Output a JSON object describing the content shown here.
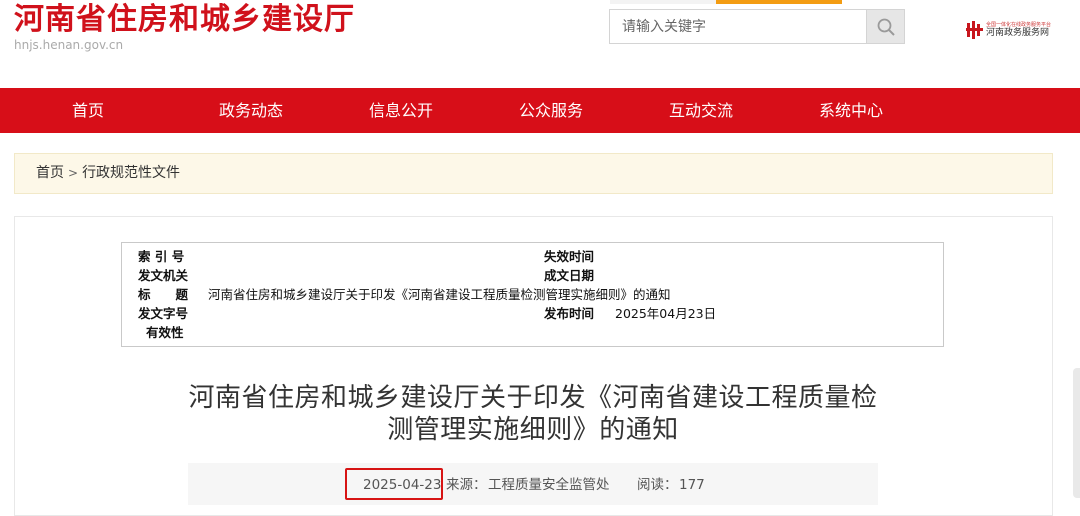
{
  "header": {
    "site_title": "河南省住房和城乡建设厅",
    "site_url": "hnjs.henan.gov.cn",
    "search_placeholder": "请输入关键字",
    "gov_logo_small": "全国一体化在线政务服务平台",
    "gov_logo_text": "河南政务服务网",
    "accent_color": "#d70e18"
  },
  "nav": {
    "items": [
      "首页",
      "政务动态",
      "信息公开",
      "公众服务",
      "互动交流",
      "系统中心"
    ]
  },
  "breadcrumb": {
    "home": "首页",
    "separator": ">",
    "current": "行政规范性文件"
  },
  "meta": {
    "index_label": "索 引 号",
    "index_value": "",
    "expire_label": "失效时间",
    "expire_value": "",
    "issuer_label": "发文机关",
    "issuer_value": "",
    "created_label": "成文日期",
    "created_value": "",
    "subject_label": "标　　题",
    "subject_value": "河南省住房和城乡建设厅关于印发《河南省建设工程质量检测管理实施细则》的通知",
    "docno_label": "发文字号",
    "docno_value": "",
    "published_label": "发布时间",
    "published_value": "2025年04月23日",
    "validity_label": "有效性",
    "validity_value": ""
  },
  "article": {
    "title_line1": "河南省住房和城乡建设厅关于印发《河南省建设工程质量检",
    "title_line2": "测管理实施细则》的通知",
    "date": "2025-04-23",
    "source_label": "来源：",
    "source": "工程质量安全监管处",
    "reads_label": "阅读：",
    "reads": "177"
  }
}
